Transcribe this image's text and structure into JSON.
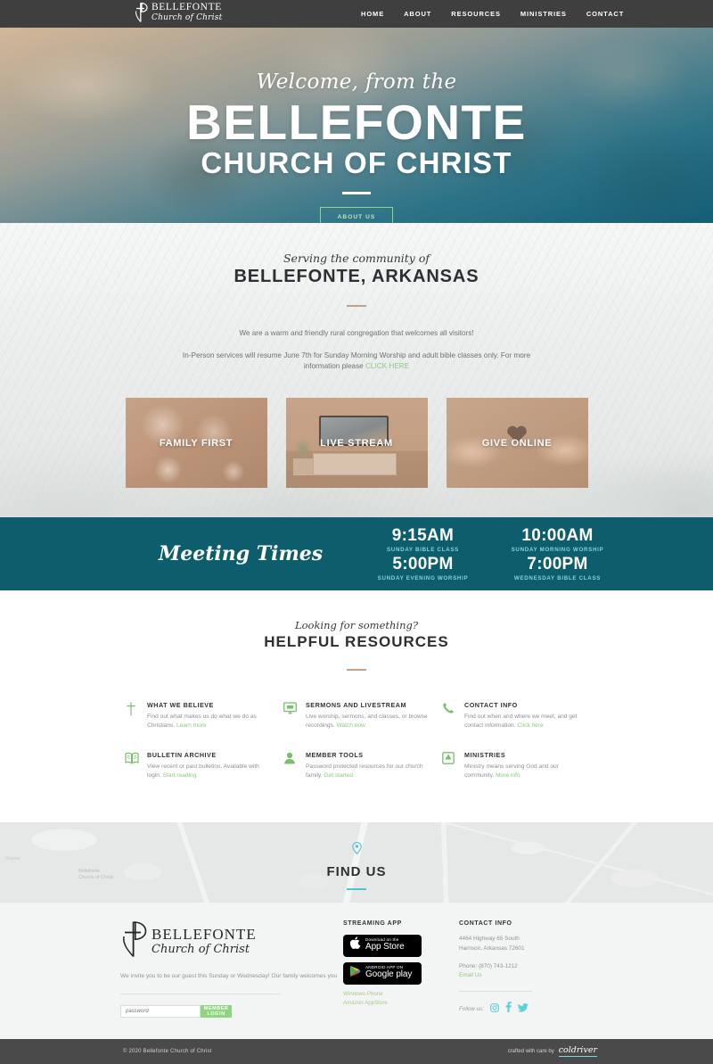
{
  "nav": {
    "logo_name": "BELLEFONTE",
    "logo_sub": "Church of Christ",
    "items": [
      {
        "label": "HOME"
      },
      {
        "label": "ABOUT"
      },
      {
        "label": "RESOURCES"
      },
      {
        "label": "MINISTRIES"
      },
      {
        "label": "CONTACT"
      }
    ]
  },
  "hero": {
    "script": "Welcome, from the",
    "title": "BELLEFONTE",
    "subtitle": "CHURCH OF CHRIST",
    "button": "ABOUT US"
  },
  "serving": {
    "script": "Serving the community of",
    "title": "BELLEFONTE, ARKANSAS",
    "paragraph1": "We are a warm and friendly rural congregation that welcomes all visitors!",
    "paragraph2_pre": "In-Person services will resume June 7th for Sunday Morning Worship and adult bible classes only. For more information please ",
    "paragraph2_link": "CLICK HERE",
    "cards": [
      {
        "label": "FAMILY FIRST"
      },
      {
        "label": "LIVE STREAM"
      },
      {
        "label": "GIVE ONLINE"
      }
    ]
  },
  "meeting": {
    "title": "Meeting Times",
    "times": [
      {
        "time": "9:15AM",
        "label": "SUNDAY BIBLE CLASS"
      },
      {
        "time": "10:00AM",
        "label": "SUNDAY MORNING WORSHIP"
      },
      {
        "time": "5:00PM",
        "label": "SUNDAY EVENING WORSHIP"
      },
      {
        "time": "7:00PM",
        "label": "WEDNESDAY BIBLE CLASS"
      }
    ]
  },
  "resources": {
    "script": "Looking for something?",
    "title": "HELPFUL RESOURCES",
    "items": [
      {
        "icon": "cross-icon",
        "heading": "WHAT WE BELIEVE",
        "text": "Find out what makes us do what we do as Christians. ",
        "link": "Learn more"
      },
      {
        "icon": "monitor-icon",
        "heading": "SERMONS AND LIVESTREAM",
        "text": "Live worship, sermons, and classes, or browse recordings. ",
        "link": "Watch now"
      },
      {
        "icon": "phone-icon",
        "heading": "CONTACT INFO",
        "text": "Find out when and where we meet, and get contact information. ",
        "link": "Click here"
      },
      {
        "icon": "book-icon",
        "heading": "BULLETIN ARCHIVE",
        "text": "View recent or past bulletins. Available with login. ",
        "link": "Start reading"
      },
      {
        "icon": "user-icon",
        "heading": "MEMBER TOOLS",
        "text": "Password protected resources for our church family. ",
        "link": "Get started"
      },
      {
        "icon": "hands-icon",
        "heading": "MINISTRIES",
        "text": "Ministry means serving God and our community. ",
        "link": "More info"
      }
    ]
  },
  "findus": {
    "title": "FIND US",
    "map_label": "Bellefonte\nChurch of Christ",
    "map_label2": "Graves"
  },
  "footer": {
    "logo_name": "BELLEFONTE",
    "logo_sub": "Church of Christ",
    "invite": "We invite you to be our guest this Sunday or Wednesday! Our family welcomes you",
    "login_placeholder": "password",
    "login_button": "MEMBER LOGIN",
    "streaming_heading": "STREAMING APP",
    "appstore_small": "Download on the",
    "appstore_big": "App Store",
    "googleplay_small": "ANDROID APP ON",
    "googleplay_big": "Google play",
    "alt_links": [
      "Windows Phone",
      "Amazon AppStore"
    ],
    "contact_heading": "CONTACT INFO",
    "address_line1": "4464 Highway 65 South",
    "address_line2": "Harrison, Arkansas 72601",
    "phone": "Phone: (870) 743-1212",
    "email_link": "Email Us",
    "follow_label": "Follow us:",
    "socials": [
      "instagram-icon",
      "facebook-icon",
      "twitter-icon"
    ]
  },
  "bottombar": {
    "copyright": "© 2020 Bellefonte Church of Christ",
    "crafted_text": "crafted with care by",
    "crafted_brand": "coldriver"
  },
  "colors": {
    "nav_bg": "#3f3f3f",
    "teal": "#0d5d6d",
    "teal_light": "#7fd4db",
    "green": "#8dc97f",
    "tan": "#c0a287",
    "dark_text": "#2c3033",
    "muted_text": "#8b9094"
  }
}
